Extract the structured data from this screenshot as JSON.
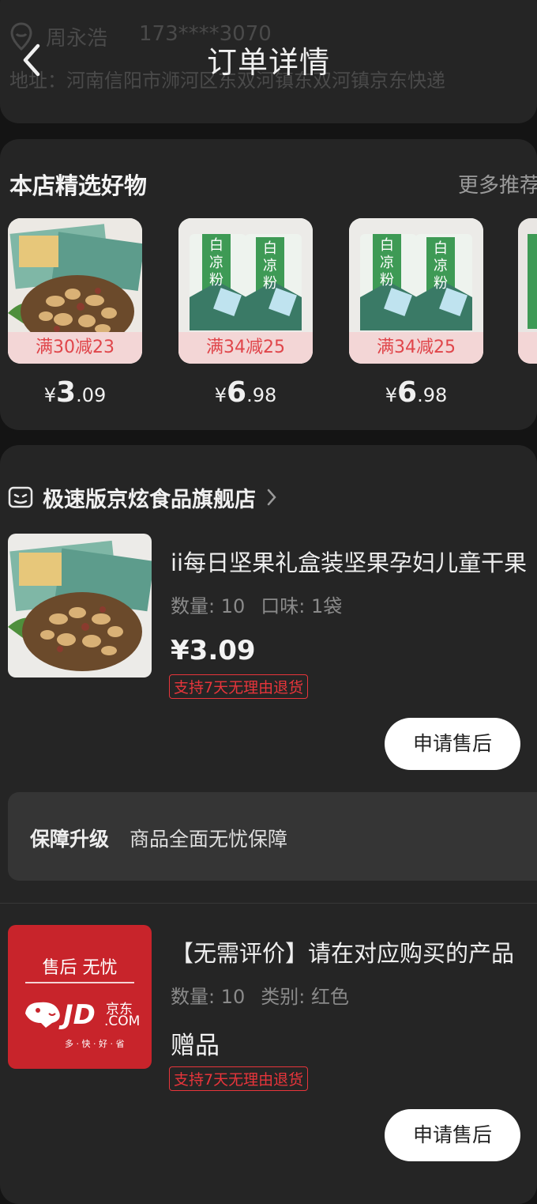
{
  "address_ghost": {
    "name": "周永浩",
    "phone": "173****3070",
    "address": "地址：河南信阳市浉河区东双河镇东双河镇京东快递"
  },
  "nav": {
    "title": "订单详情"
  },
  "recommend": {
    "title": "本店精选好物",
    "more": "更多推荐",
    "items": [
      {
        "badge": "满30减23",
        "currency": "¥",
        "int": "3",
        "dec": ".09",
        "product": "nuts"
      },
      {
        "badge": "满34减25",
        "currency": "¥",
        "int": "6",
        "dec": ".98",
        "product": "noodle"
      },
      {
        "badge": "满34减25",
        "currency": "¥",
        "int": "6",
        "dec": ".98",
        "product": "noodle"
      }
    ],
    "noodle_text": "白凉粉"
  },
  "order": {
    "store_name": "极速版京炫食品旗舰店",
    "products": [
      {
        "title": "ii每日坚果礼盒装坚果孕妇儿童干果",
        "qty": "数量: 10",
        "spec": "口味: 1袋",
        "price": "¥3.09",
        "tag": "支持7天无理由退货",
        "button": "申请售后"
      },
      {
        "title": "【无需评价】请在对应购买的产品",
        "qty": "数量: 10",
        "spec": "类别: 红色",
        "price": "赠品",
        "tag": "支持7天无理由退货",
        "button": "申请售后"
      }
    ],
    "guarantee": {
      "title": "保障升级",
      "text": "商品全面无忧保障"
    }
  },
  "jd_card": {
    "line1": "售后 无忧",
    "brand": "JD",
    "brand_cn": "京东",
    "domain": ".COM",
    "slogan": "多 · 快 · 好 · 省"
  },
  "colors": {
    "background": "#141414",
    "card": "#252525",
    "accent_red": "#e8353b",
    "badge_bg": "#f3d6d6"
  }
}
